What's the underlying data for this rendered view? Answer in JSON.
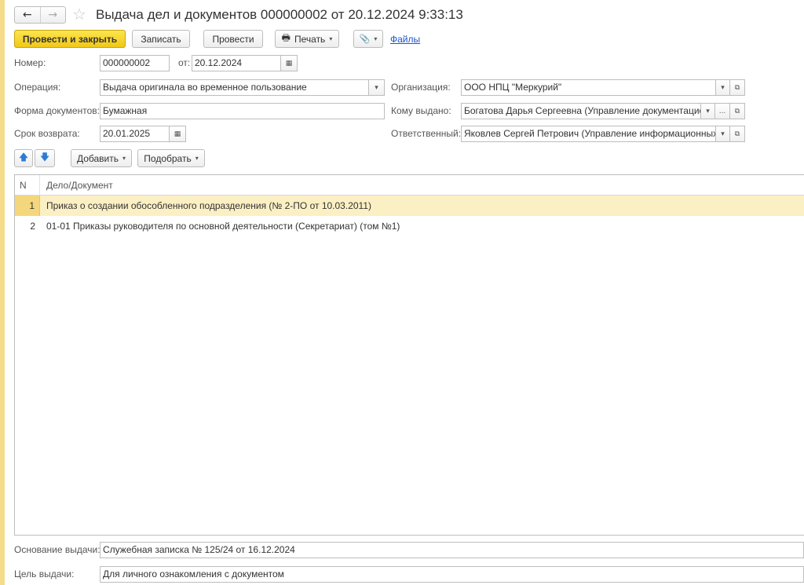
{
  "header": {
    "back": "←",
    "forward": "→",
    "star": "☆",
    "title": "Выдача дел и документов 000000002 от 20.12.2024 9:33:13"
  },
  "toolbar": {
    "post_close": "Провести и закрыть",
    "save": "Записать",
    "post": "Провести",
    "print": "Печать",
    "print_icon": "🖶",
    "attach_icon": "📎",
    "caret": "▾",
    "files": "Файлы"
  },
  "form": {
    "number_label": "Номер:",
    "number_value": "000000002",
    "date_label": "от:",
    "date_value": "20.12.2024",
    "operation_label": "Операция:",
    "operation_value": "Выдача оригинала во временное пользование",
    "org_label": "Организация:",
    "org_value": "ООО НПЦ \"Меркурий\"",
    "doc_form_label": "Форма документов:",
    "doc_form_value": "Бумажная",
    "issued_to_label": "Кому выдано:",
    "issued_to_value": "Богатова Дарья Сергеевна (Управление документационн",
    "return_label": "Срок возврата:",
    "return_value": "20.01.2025",
    "responsible_label": "Ответственный:",
    "responsible_value": "Яковлев Сергей Петрович (Управление информационных те:",
    "calendar_icon": "▦",
    "dropdown_icon": "▾",
    "open_icon": "⧉",
    "ellipsis": "..."
  },
  "table_toolbar": {
    "up_icon": "🡅",
    "down_icon": "🡇",
    "add": "Добавить",
    "pick": "Подобрать"
  },
  "table": {
    "col_n": "N",
    "col_doc": "Дело/Документ",
    "rows": [
      {
        "n": "1",
        "doc": "Приказ о создании обособленного подразделения (№ 2-ПО от 10.03.2011)"
      },
      {
        "n": "2",
        "doc": "01-01 Приказы руководителя по основной деятельности (Секретариат) (том №1)"
      }
    ]
  },
  "footer": {
    "basis_label": "Основание выдачи:",
    "basis_value": "Служебная записка № 125/24 от 16.12.2024",
    "purpose_label": "Цель выдачи:",
    "purpose_value": "Для личного ознакомления с документом"
  }
}
